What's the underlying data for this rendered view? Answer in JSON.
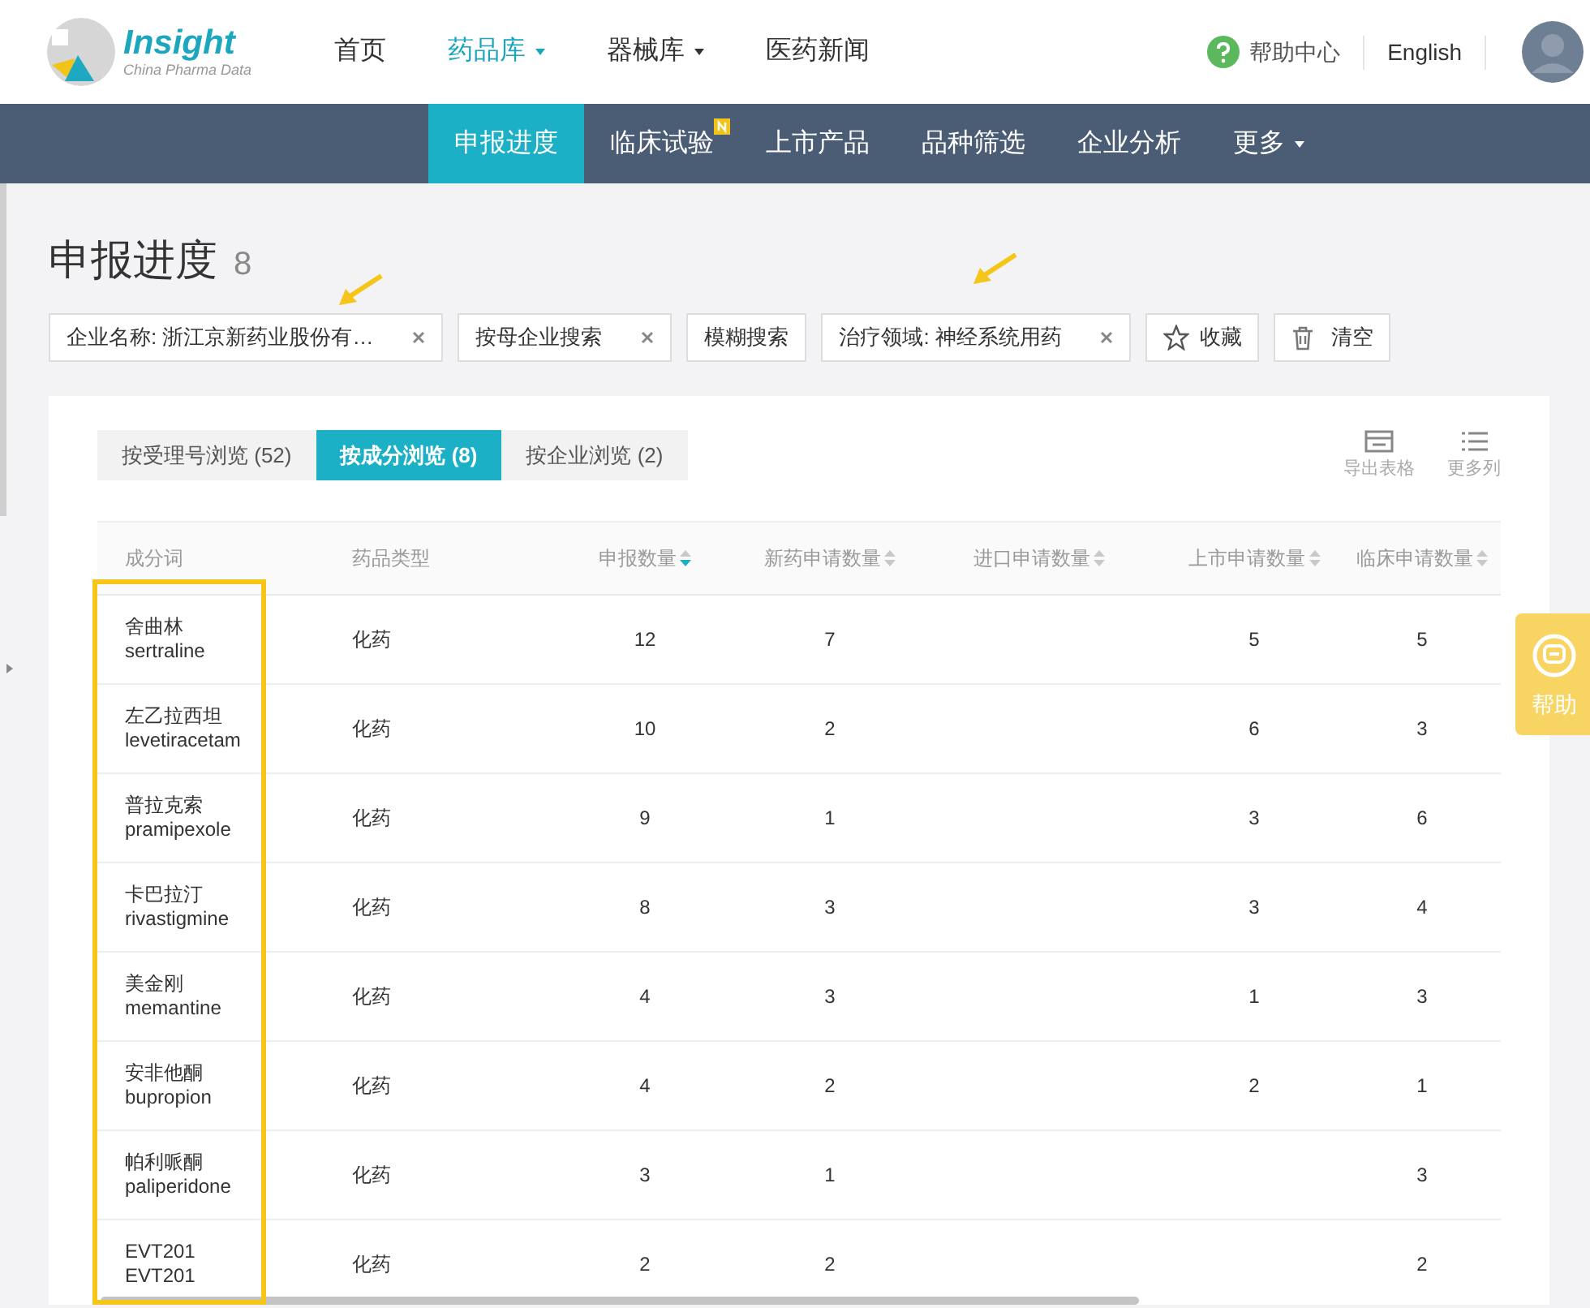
{
  "header": {
    "logo": {
      "name": "Insight",
      "tagline": "China Pharma Data"
    },
    "nav": [
      {
        "label": "首页",
        "selected": false,
        "dropdown": false
      },
      {
        "label": "药品库",
        "selected": true,
        "dropdown": true
      },
      {
        "label": "器械库",
        "selected": false,
        "dropdown": true
      },
      {
        "label": "医药新闻",
        "selected": false,
        "dropdown": false
      }
    ],
    "help": "帮助中心",
    "language": "English"
  },
  "subnav": [
    {
      "label": "申报进度",
      "selected": true,
      "badge": false,
      "dropdown": false
    },
    {
      "label": "临床试验",
      "selected": false,
      "badge": true,
      "dropdown": false
    },
    {
      "label": "上市产品",
      "selected": false,
      "badge": false,
      "dropdown": false
    },
    {
      "label": "品种筛选",
      "selected": false,
      "badge": false,
      "dropdown": false
    },
    {
      "label": "企业分析",
      "selected": false,
      "badge": false,
      "dropdown": false
    },
    {
      "label": "更多",
      "selected": false,
      "badge": false,
      "dropdown": true
    }
  ],
  "page": {
    "title": "申报进度",
    "count": "8"
  },
  "filters": [
    {
      "kind": "chip",
      "label": "企业名称: 浙江京新药业股份有…"
    },
    {
      "kind": "chip",
      "label": "按母企业搜索"
    },
    {
      "kind": "plain",
      "label": "模糊搜索"
    },
    {
      "kind": "chip",
      "label": "治疗领域: 神经系统用药"
    },
    {
      "kind": "star",
      "label": "收藏"
    },
    {
      "kind": "trash",
      "label": "清空"
    }
  ],
  "tabs": [
    {
      "label": "按受理号浏览 (52)",
      "selected": false
    },
    {
      "label": "按成分浏览 (8)",
      "selected": true
    },
    {
      "label": "按企业浏览 (2)",
      "selected": false
    }
  ],
  "tools": [
    {
      "kind": "export",
      "label": "导出表格"
    },
    {
      "kind": "columns",
      "label": "更多列"
    }
  ],
  "table": {
    "columns": [
      {
        "label": "成分词",
        "sortable": false
      },
      {
        "label": "药品类型",
        "sortable": false
      },
      {
        "label": "申报数量",
        "sorted": true,
        "sortable": true
      },
      {
        "label": "新药申请数量",
        "sorted": false,
        "sortable": true
      },
      {
        "label": "进口申请数量",
        "sorted": false,
        "sortable": true
      },
      {
        "label": "上市申请数量",
        "sorted": false,
        "sortable": true
      },
      {
        "label": "临床申请数量",
        "sorted": false,
        "sortable": true
      }
    ],
    "rows": [
      {
        "name_cn": "舍曲林",
        "name_en": "sertraline",
        "type": "化药",
        "total": "12",
        "new": "7",
        "market": "5",
        "clinical": "5"
      },
      {
        "name_cn": "左乙拉西坦",
        "name_en": "levetiracetam",
        "type": "化药",
        "total": "10",
        "new": "2",
        "market": "6",
        "clinical": "3"
      },
      {
        "name_cn": "普拉克索",
        "name_en": "pramipexole",
        "type": "化药",
        "total": "9",
        "new": "1",
        "market": "3",
        "clinical": "6"
      },
      {
        "name_cn": "卡巴拉汀",
        "name_en": "rivastigmine",
        "type": "化药",
        "total": "8",
        "new": "3",
        "market": "3",
        "clinical": "4"
      },
      {
        "name_cn": "美金刚",
        "name_en": "memantine",
        "type": "化药",
        "total": "4",
        "new": "3",
        "market": "1",
        "clinical": "3"
      },
      {
        "name_cn": "安非他酮",
        "name_en": "bupropion",
        "type": "化药",
        "total": "4",
        "new": "2",
        "market": "2",
        "clinical": "1"
      },
      {
        "name_cn": "帕利哌酮",
        "name_en": "paliperidone",
        "type": "化药",
        "total": "3",
        "new": "1",
        "clinical": "3"
      },
      {
        "name_cn": "EVT201",
        "name_en": "EVT201",
        "type": "化药",
        "total": "2",
        "new": "2",
        "clinical": "2"
      }
    ]
  },
  "help_tab": "帮助"
}
